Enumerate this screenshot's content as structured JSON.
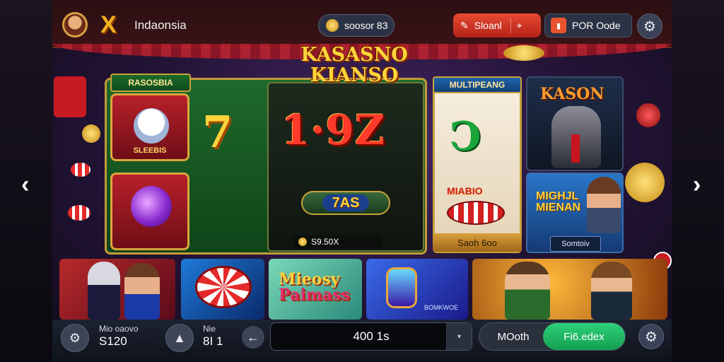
{
  "header": {
    "brand_mark": "X",
    "region": "Indaonsia",
    "balance": "soosor 83",
    "action_label": "Sloanl",
    "promo_code_label": "POR Oode"
  },
  "game": {
    "logo_line1": "KASASNO",
    "logo_line2": "KIANSO",
    "left_tile_label": "RASOSBIA",
    "card1_caption": "SLEEBIS",
    "seven": "7",
    "big_number": "1·9Z",
    "pill_value": "7AS",
    "mini_balance": "S9.50X",
    "multi_label": "MULTIPEANG",
    "multi_text": "MIABIO",
    "multi_button": "Saoh 6oo",
    "kason_title": "KASON",
    "woman_title_1": "MIGHJL",
    "woman_title_2": "MIENAN",
    "woman_button": "Somtoiv"
  },
  "thumbnails": {
    "t3_line1": "Mieosy",
    "t3_line2": "Paimass",
    "t4_label": "BOMKWOE"
  },
  "bottom": {
    "stat1_label": "Mio oaovo",
    "stat1_value": "S120",
    "stat2_label": "Nie",
    "stat2_value": "8I 1",
    "bet_value": "400 1s",
    "mode_option_1": "MOoth",
    "mode_option_2": "Fi6.edex"
  },
  "colors": {
    "accent_red": "#e84a32",
    "accent_green": "#2ed07a",
    "gold": "#ffd23a"
  },
  "icons": {
    "settings": "gear-icon",
    "back": "arrow-left-icon",
    "prev": "chevron-left-icon",
    "next": "chevron-right-icon"
  }
}
